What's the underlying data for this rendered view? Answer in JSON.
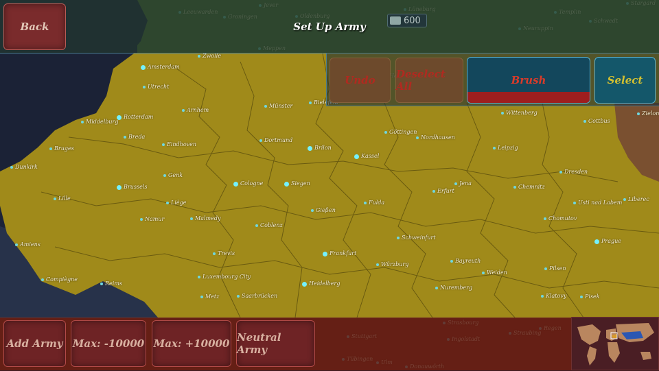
{
  "header": {
    "title": "Set Up Army",
    "back_label": "Back",
    "troops": "600"
  },
  "toolbar": {
    "undo": "Undo",
    "deselect_all": "Deselect All",
    "brush": "Brush",
    "select": "Select"
  },
  "footer": {
    "add_army": "Add Army",
    "max_minus": "Max: -10000",
    "max_plus": "Max: +10000",
    "neutral_army": "Neutral Army"
  },
  "colors": {
    "territory": "#a08a1a",
    "sea": "#1c2338",
    "enemy_red": "#8a2a1a",
    "neighbour_brown": "#7a5030",
    "brush_active": "#9e1e1e"
  },
  "icons": {
    "troops": "army-icon",
    "capital": "star-icon"
  },
  "cities": [
    {
      "name": "Amsterdam",
      "big": true
    },
    {
      "name": "Zwolle",
      "big": false
    },
    {
      "name": "Utrecht",
      "big": false
    },
    {
      "name": "Middelburg",
      "big": false
    },
    {
      "name": "Rotterdam",
      "big": true
    },
    {
      "name": "Arnhem",
      "big": false
    },
    {
      "name": "Münster",
      "big": false
    },
    {
      "name": "Bielefeld",
      "big": false
    },
    {
      "name": "Hannover",
      "big": false
    },
    {
      "name": "Breda",
      "big": false
    },
    {
      "name": "Eindhoven",
      "big": false
    },
    {
      "name": "Dortmund",
      "big": false
    },
    {
      "name": "Brilon",
      "big": true
    },
    {
      "name": "Kassel",
      "big": true
    },
    {
      "name": "Göttingen",
      "big": false
    },
    {
      "name": "Nordhausen",
      "big": false
    },
    {
      "name": "Wittenberg",
      "big": false
    },
    {
      "name": "Cottbus",
      "big": false
    },
    {
      "name": "Zielona",
      "big": false
    },
    {
      "name": "Bruges",
      "big": false
    },
    {
      "name": "Dunkirk",
      "big": false
    },
    {
      "name": "Brussels",
      "big": true
    },
    {
      "name": "Genk",
      "big": false
    },
    {
      "name": "Cologne",
      "big": true
    },
    {
      "name": "Siegen",
      "big": true
    },
    {
      "name": "Leipzig",
      "big": false
    },
    {
      "name": "Dresden",
      "big": false
    },
    {
      "name": "Lille",
      "big": false
    },
    {
      "name": "Liège",
      "big": false
    },
    {
      "name": "Gießen",
      "big": false
    },
    {
      "name": "Fulda",
      "big": false
    },
    {
      "name": "Erfurt",
      "big": false
    },
    {
      "name": "Jena",
      "big": false
    },
    {
      "name": "Chemnitz",
      "big": false
    },
    {
      "name": "Usti nad Labem",
      "big": false
    },
    {
      "name": "Liberec",
      "big": false
    },
    {
      "name": "Namur",
      "big": false
    },
    {
      "name": "Malmedy",
      "big": false
    },
    {
      "name": "Coblenz",
      "big": false
    },
    {
      "name": "Chomutov",
      "big": false
    },
    {
      "name": "Amiens",
      "big": false
    },
    {
      "name": "Schweinfurt",
      "big": false
    },
    {
      "name": "Prague",
      "big": true
    },
    {
      "name": "Trevis",
      "big": false
    },
    {
      "name": "Frankfurt",
      "big": true
    },
    {
      "name": "Würzburg",
      "big": false
    },
    {
      "name": "Bayreuth",
      "big": false
    },
    {
      "name": "Compiègne",
      "big": false
    },
    {
      "name": "Luxembourg City",
      "big": false
    },
    {
      "name": "Weiden",
      "big": false
    },
    {
      "name": "Pilsen",
      "big": false
    },
    {
      "name": "Reims",
      "big": false
    },
    {
      "name": "Heidelberg",
      "big": true
    },
    {
      "name": "Nuremberg",
      "big": false
    },
    {
      "name": "Metz",
      "big": false
    },
    {
      "name": "Saarbrücken",
      "big": false
    },
    {
      "name": "Klatovy",
      "big": false
    },
    {
      "name": "Pisek",
      "big": false
    },
    {
      "name": "Leeuwarden",
      "big": false
    },
    {
      "name": "Groningen",
      "big": false
    },
    {
      "name": "Jever",
      "big": false
    },
    {
      "name": "Oldenburg",
      "big": false
    },
    {
      "name": "Lüneburg",
      "big": false
    },
    {
      "name": "Meppen",
      "big": false
    },
    {
      "name": "Templin",
      "big": false
    },
    {
      "name": "Schwedt",
      "big": false
    },
    {
      "name": "Stargard",
      "big": false
    },
    {
      "name": "Neuruppin",
      "big": false
    },
    {
      "name": "Stuttgart",
      "big": false
    },
    {
      "name": "Ingolstadt",
      "big": false
    },
    {
      "name": "Straubing",
      "big": false
    },
    {
      "name": "Regen",
      "big": false
    },
    {
      "name": "Tübingen",
      "big": false
    },
    {
      "name": "Ulm",
      "big": false
    },
    {
      "name": "Donauwörth",
      "big": false
    },
    {
      "name": "Strasbourg",
      "big": false
    }
  ]
}
